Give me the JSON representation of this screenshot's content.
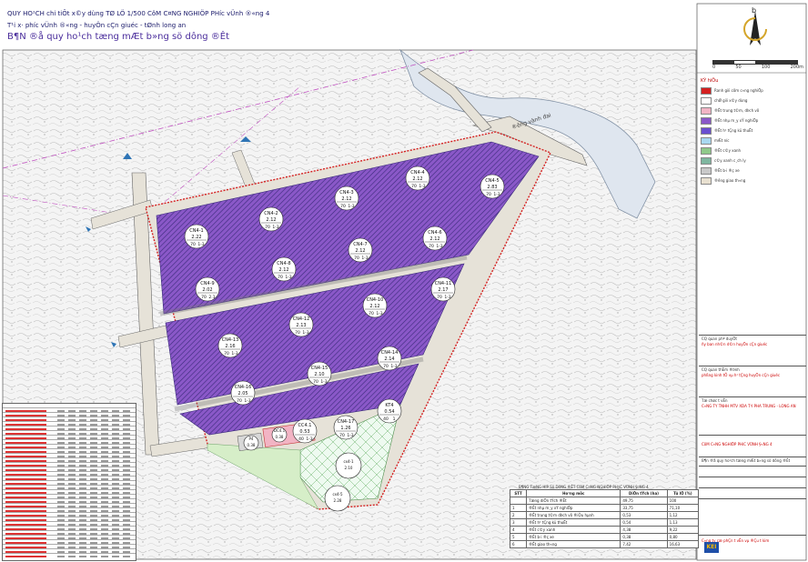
{
  "header": {
    "line1": "QUY HO¹CH chi tiÕt x©y dùng TØ LÖ 1/500 CôM C¤NG NGHIÖP PH­íc vÜnh ®«ng 4",
    "line2": "T¹i x· ph­íc vÜnh ®«ng - huyÖn cÇn giuéc - tØnh long an",
    "line3": "B¶N ®å quy ho¹ch tæng mÆt b»ng sö dông ®Êt"
  },
  "road_label": "®­êng vành đai",
  "lots": [
    {
      "code": "CN4-1",
      "area": "2.22",
      "density": "70",
      "floors": "1-3"
    },
    {
      "code": "CN4-2",
      "area": "2.12",
      "density": "70",
      "floors": "1-3"
    },
    {
      "code": "CN4-3",
      "area": "2.12",
      "density": "70",
      "floors": "1-3"
    },
    {
      "code": "CN4-4",
      "area": "2.12",
      "density": "70",
      "floors": "1-3"
    },
    {
      "code": "CN4-5",
      "area": "2.83",
      "density": "70",
      "floors": "1-3"
    },
    {
      "code": "CN4-6",
      "area": "2.12",
      "density": "70",
      "floors": "1-3"
    },
    {
      "code": "CN4-7",
      "area": "2.12",
      "density": "70",
      "floors": "1-3"
    },
    {
      "code": "CN4-8",
      "area": "2.12",
      "density": "70",
      "floors": "1-3"
    },
    {
      "code": "CN4-9",
      "area": "2.02",
      "density": "70",
      "floors": "2.1"
    },
    {
      "code": "CN4-10",
      "area": "2.12",
      "density": "70",
      "floors": "1-3"
    },
    {
      "code": "CN4-11",
      "area": "2.17",
      "density": "70",
      "floors": "1-3"
    },
    {
      "code": "CN4-12",
      "area": "2.13",
      "density": "70",
      "floors": "1-3"
    },
    {
      "code": "CN4-13",
      "area": "2.16",
      "density": "70",
      "floors": "1-3"
    },
    {
      "code": "CN4-14",
      "area": "2.14",
      "density": "70",
      "floors": "1-3"
    },
    {
      "code": "CN4-15",
      "area": "2.10",
      "density": "70",
      "floors": "1-3"
    },
    {
      "code": "CN4-16",
      "area": "2.05",
      "density": "70",
      "floors": "1-3"
    },
    {
      "code": "CN4-17",
      "area": "1.26",
      "density": "70",
      "floors": "1-3"
    },
    {
      "code": "KT4",
      "area": "0.54",
      "density": "40",
      "floors": "1"
    },
    {
      "code": "CC4.1",
      "area": "0.53",
      "density": "40",
      "floors": "1-3"
    },
    {
      "code": "DC4.1",
      "area": "0.38",
      "density": "",
      "floors": ""
    },
    {
      "code": "P4",
      "area": "0.38",
      "density": "",
      "floors": ""
    },
    {
      "code": "cx4-1",
      "area": "2.10",
      "density": "",
      "floors": ""
    },
    {
      "code": "cx4-5",
      "area": "2.28",
      "density": "",
      "floors": ""
    }
  ],
  "legend": {
    "title": "KÝ hiÖu",
    "items": [
      {
        "label": "Ranh giíi côm c«ng nghiÖp",
        "color": "#d42020"
      },
      {
        "label": "chØ giíi x©y dùng",
        "color": "#ffffff"
      },
      {
        "label": "®Êt trung t©m, dÞch vô",
        "color": "#f2b4c4"
      },
      {
        "label": "®Êt nhµ m¸y xÝ nghiÖp",
        "color": "#8a58c8"
      },
      {
        "label": "®Êt h¹ tÇng kü thuËt",
        "color": "#6a4fd0"
      },
      {
        "label": "mÆt n­íc",
        "color": "#a8d8f0"
      },
      {
        "label": "®Êt c©y xanh",
        "color": "#8fc98a"
      },
      {
        "label": "c©y xanh c¸ch ly",
        "color": "#7fb7a0"
      },
      {
        "label": "®Êt b·i ®ç xe",
        "color": "#c9c9c9"
      },
      {
        "label": "®­êng giao th«ng",
        "color": "#e8e0d0"
      }
    ]
  },
  "scale": {
    "ticks": [
      "0",
      "50",
      "100",
      "200m"
    ]
  },
  "table": {
    "title": "B¶NG TæNG HîP Sö DôNG ®ÊT CôM C¤NG NGHIÖP PH¦íC VÜNH §¤NG 4",
    "headers": [
      "STT",
      "Ho¹ng môc",
      "DiÖn tÝch (ha)",
      "Tû lÖ (%)"
    ],
    "rows": [
      [
        "",
        "Tæng diÖn tÝch ®Êt",
        "49,75",
        "100"
      ],
      [
        "1",
        "®Êt nhµ m¸y xÝ nghiÖp",
        "33,75",
        "71,10"
      ],
      [
        "2",
        "®Êt trung t©m dÞch vô ®iÒu hµnh",
        "0,53",
        "1,12"
      ],
      [
        "3",
        "®Êt h¹ tÇng kü thuËt",
        "0,54",
        "1,13"
      ],
      [
        "4",
        "®Êt c©y xanh",
        "4,38",
        "9,22"
      ],
      [
        "5",
        "®Êt b·i ®ç xe",
        "0,38",
        "0,80"
      ],
      [
        "6",
        "®Êt giao th«ng",
        "7,42",
        "16,63"
      ]
    ]
  },
  "titleblock": {
    "approval": "CQ quan phª duyÖt",
    "approval_name": "ñy ban nh©n d©n huyÖn cÇn giuéc",
    "appraisal": "CQ quan thÈm ®Þnh",
    "appraisal_name": "phßng kinh tÕ vµ h¹ tÇng huyÖn cÇn giuéc",
    "consultant": "Tæ chøc t­ vÊn",
    "investor": "C«NG TY TNHH MTV XDA T¹I PHA TRUNG - LONG AN",
    "project": "CôM C«NG NGHIÖP PH­íC VÜNH §«NG 4",
    "drawing": "B¶n ®å quy ho¹ch tæng mÆt b»ng sö dông ®Êt",
    "company": "C«ng ty cæ phÇn t­ vÊn vµ ®Çu t­ kim",
    "logo": "KEI"
  },
  "colors": {
    "industrial": "#8a58c8",
    "hatch": "#3a2a7a",
    "green": "#8fc98a",
    "boundary": "#d42020",
    "road": "#e6e2d8",
    "terrain": "#c8c8c8",
    "water": "#a9b8c8"
  }
}
